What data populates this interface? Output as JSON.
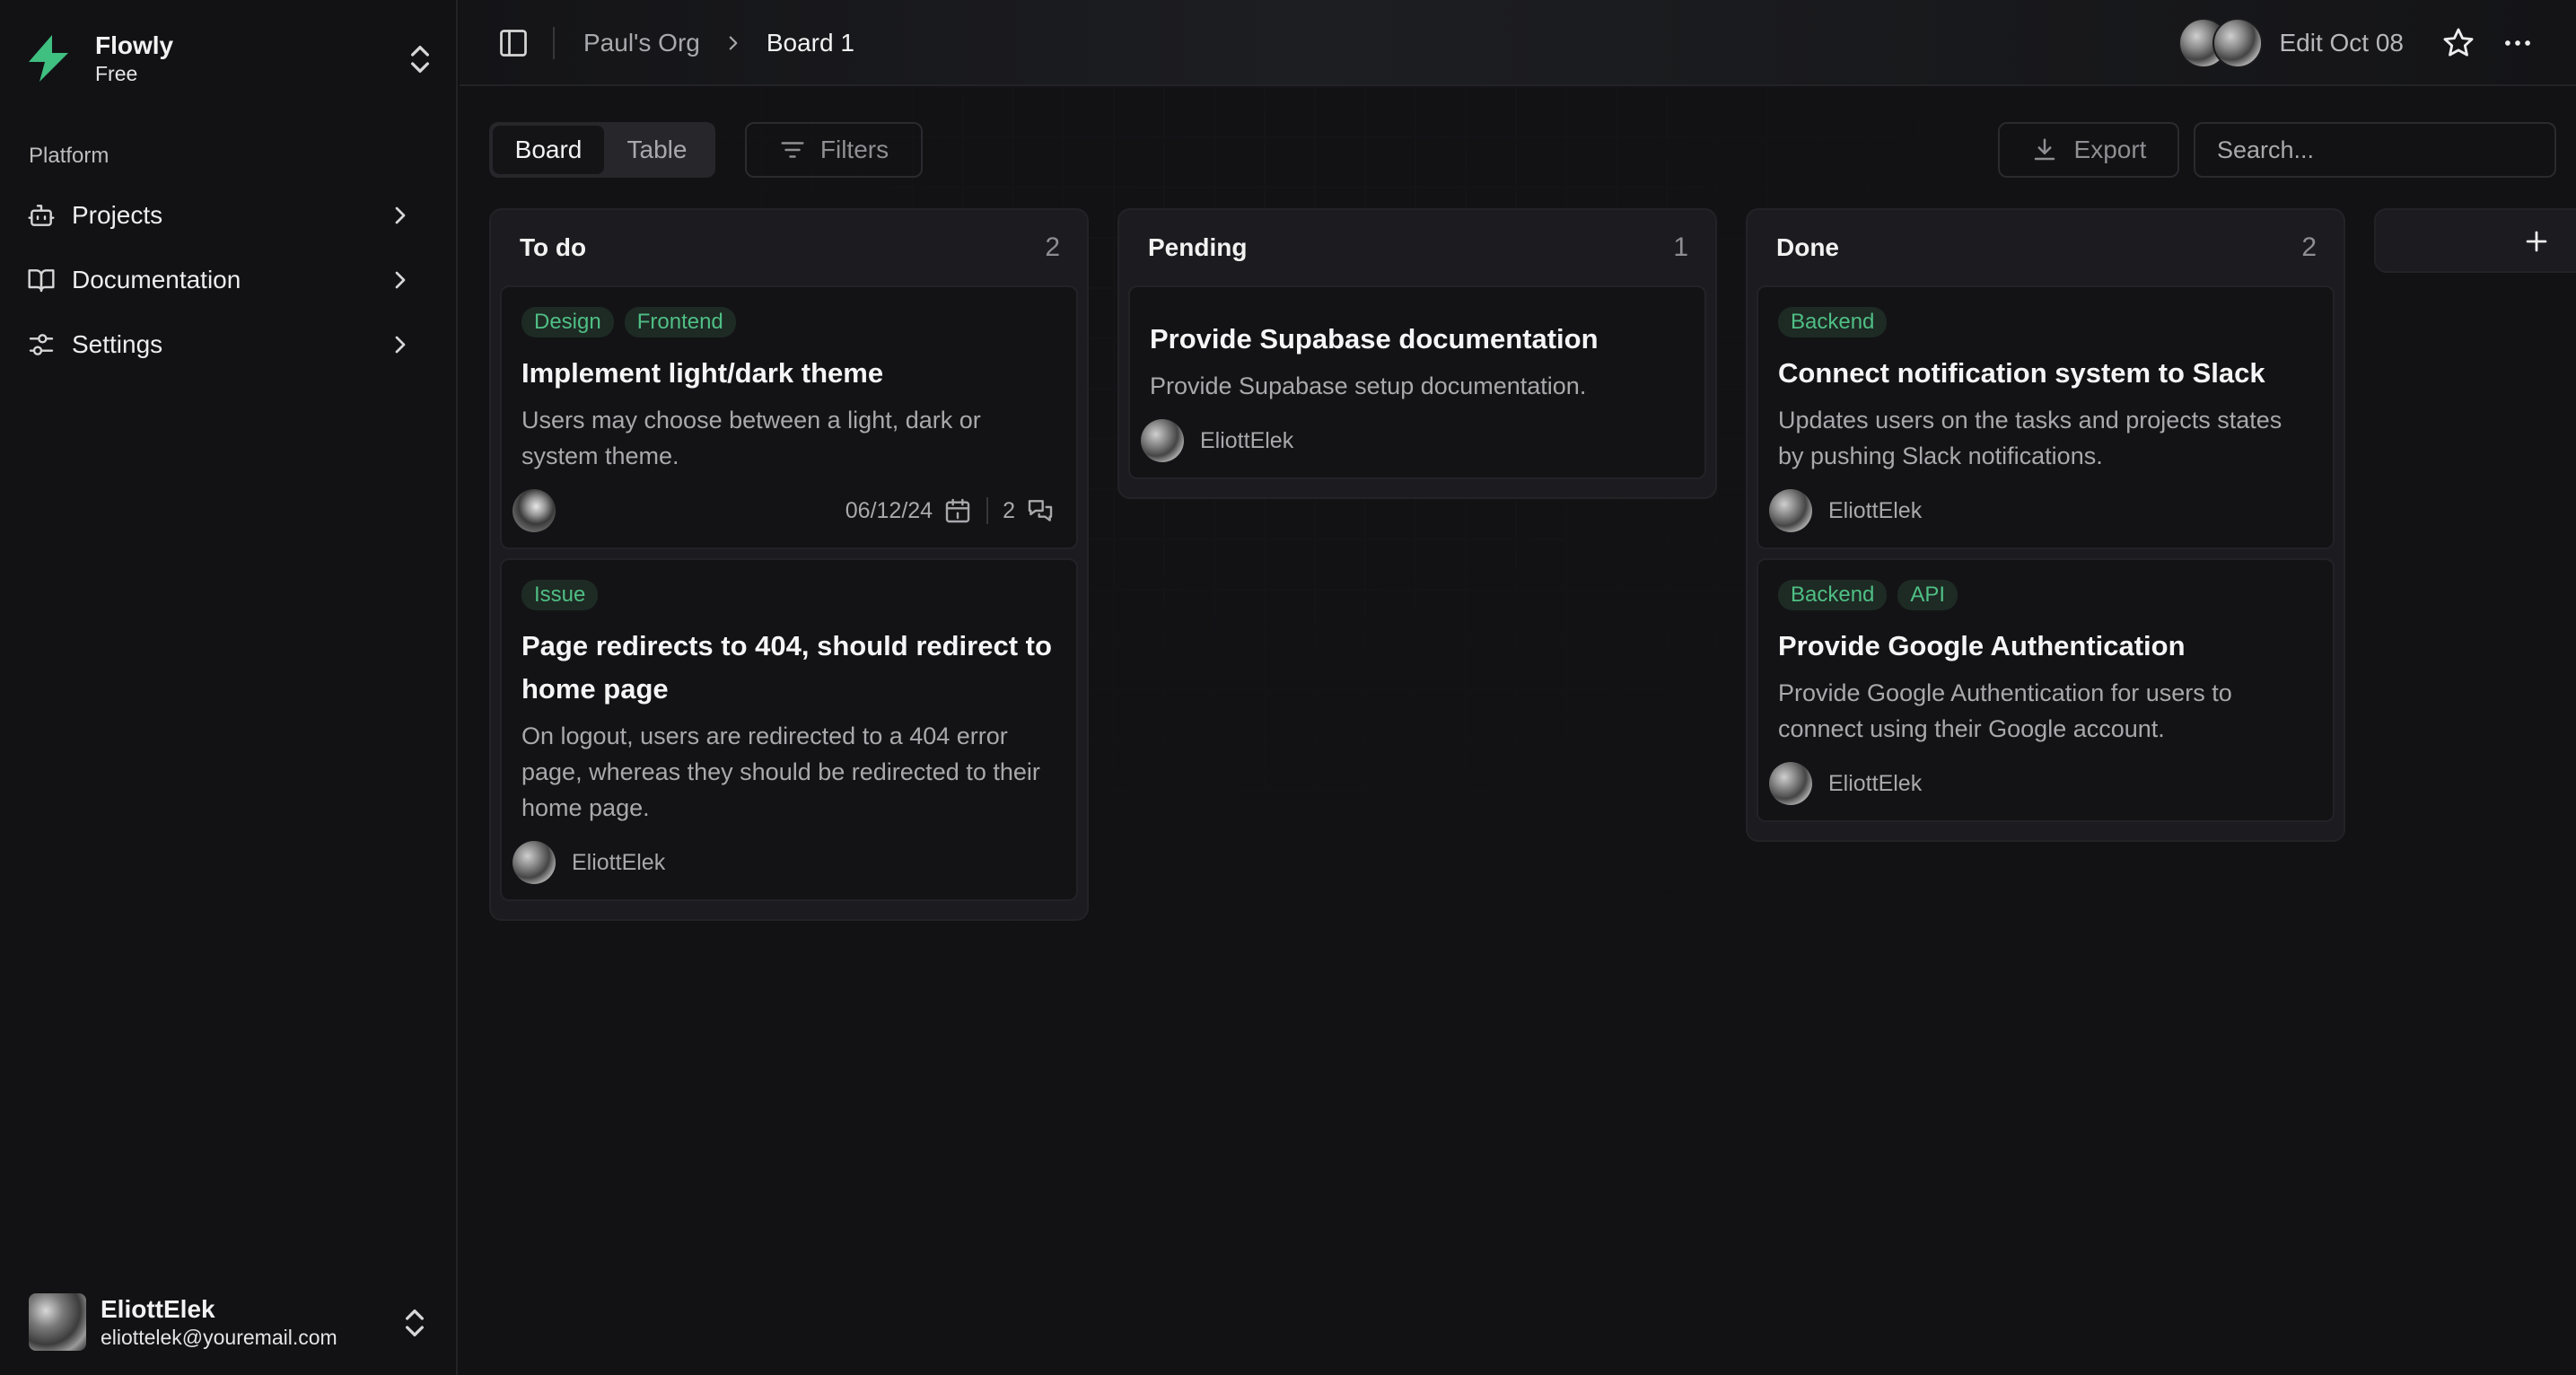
{
  "app": {
    "name": "Flowly",
    "plan": "Free",
    "accent_color": "#3fbf80"
  },
  "sidebar": {
    "section_label": "Platform",
    "items": [
      {
        "label": "Projects",
        "icon": "bot-icon"
      },
      {
        "label": "Documentation",
        "icon": "book-open-icon"
      },
      {
        "label": "Settings",
        "icon": "sliders-icon"
      }
    ],
    "user": {
      "name": "EliottElek",
      "email": "eliottelek@youremail.com"
    }
  },
  "header": {
    "breadcrumb": [
      "Paul's Org",
      "Board 1"
    ],
    "edit_label": "Edit Oct 08"
  },
  "toolbar": {
    "view_tabs": [
      "Board",
      "Table"
    ],
    "active_view": "Board",
    "filters_label": "Filters",
    "export_label": "Export",
    "search_placeholder": "Search...",
    "search_value": ""
  },
  "board": {
    "columns": [
      {
        "title": "To do",
        "count": "2",
        "cards": [
          {
            "tags": [
              "Design",
              "Frontend"
            ],
            "title": "Implement light/dark theme",
            "description": "Users may choose between a light, dark or system theme.",
            "assignee": "",
            "due_date": "06/12/24",
            "comments": "2"
          },
          {
            "tags": [
              "Issue"
            ],
            "title": "Page redirects to 404, should redirect to home page",
            "description": "On logout, users are redirected to a 404 error page, whereas they should be redirected to their home page.",
            "assignee": "EliottElek"
          }
        ]
      },
      {
        "title": "Pending",
        "count": "1",
        "cards": [
          {
            "tags": [],
            "title": "Provide Supabase documentation",
            "description": "Provide Supabase setup documentation.",
            "assignee": "EliottElek"
          }
        ]
      },
      {
        "title": "Done",
        "count": "2",
        "cards": [
          {
            "tags": [
              "Backend"
            ],
            "title": "Connect notification system to Slack",
            "description": "Updates users on the tasks and projects states by pushing Slack notifications.",
            "assignee": "EliottElek"
          },
          {
            "tags": [
              "Backend",
              "API"
            ],
            "title": "Provide Google Authentication",
            "description": "Provide Google Authentication for users to connect using their Google account.",
            "assignee": "EliottElek"
          }
        ]
      }
    ]
  }
}
